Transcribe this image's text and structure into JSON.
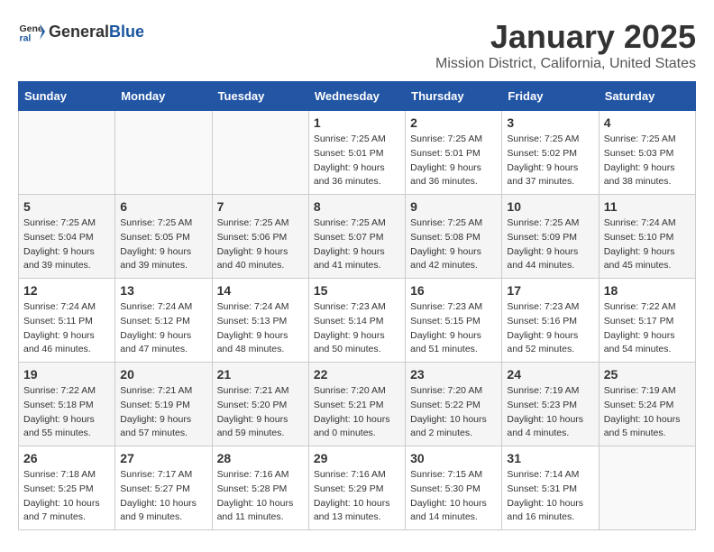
{
  "header": {
    "logo_general": "General",
    "logo_blue": "Blue",
    "title": "January 2025",
    "subtitle": "Mission District, California, United States"
  },
  "weekdays": [
    "Sunday",
    "Monday",
    "Tuesday",
    "Wednesday",
    "Thursday",
    "Friday",
    "Saturday"
  ],
  "weeks": [
    [
      {
        "day": "",
        "info": ""
      },
      {
        "day": "",
        "info": ""
      },
      {
        "day": "",
        "info": ""
      },
      {
        "day": "1",
        "info": "Sunrise: 7:25 AM\nSunset: 5:01 PM\nDaylight: 9 hours and 36 minutes."
      },
      {
        "day": "2",
        "info": "Sunrise: 7:25 AM\nSunset: 5:01 PM\nDaylight: 9 hours and 36 minutes."
      },
      {
        "day": "3",
        "info": "Sunrise: 7:25 AM\nSunset: 5:02 PM\nDaylight: 9 hours and 37 minutes."
      },
      {
        "day": "4",
        "info": "Sunrise: 7:25 AM\nSunset: 5:03 PM\nDaylight: 9 hours and 38 minutes."
      }
    ],
    [
      {
        "day": "5",
        "info": "Sunrise: 7:25 AM\nSunset: 5:04 PM\nDaylight: 9 hours and 39 minutes."
      },
      {
        "day": "6",
        "info": "Sunrise: 7:25 AM\nSunset: 5:05 PM\nDaylight: 9 hours and 39 minutes."
      },
      {
        "day": "7",
        "info": "Sunrise: 7:25 AM\nSunset: 5:06 PM\nDaylight: 9 hours and 40 minutes."
      },
      {
        "day": "8",
        "info": "Sunrise: 7:25 AM\nSunset: 5:07 PM\nDaylight: 9 hours and 41 minutes."
      },
      {
        "day": "9",
        "info": "Sunrise: 7:25 AM\nSunset: 5:08 PM\nDaylight: 9 hours and 42 minutes."
      },
      {
        "day": "10",
        "info": "Sunrise: 7:25 AM\nSunset: 5:09 PM\nDaylight: 9 hours and 44 minutes."
      },
      {
        "day": "11",
        "info": "Sunrise: 7:24 AM\nSunset: 5:10 PM\nDaylight: 9 hours and 45 minutes."
      }
    ],
    [
      {
        "day": "12",
        "info": "Sunrise: 7:24 AM\nSunset: 5:11 PM\nDaylight: 9 hours and 46 minutes."
      },
      {
        "day": "13",
        "info": "Sunrise: 7:24 AM\nSunset: 5:12 PM\nDaylight: 9 hours and 47 minutes."
      },
      {
        "day": "14",
        "info": "Sunrise: 7:24 AM\nSunset: 5:13 PM\nDaylight: 9 hours and 48 minutes."
      },
      {
        "day": "15",
        "info": "Sunrise: 7:23 AM\nSunset: 5:14 PM\nDaylight: 9 hours and 50 minutes."
      },
      {
        "day": "16",
        "info": "Sunrise: 7:23 AM\nSunset: 5:15 PM\nDaylight: 9 hours and 51 minutes."
      },
      {
        "day": "17",
        "info": "Sunrise: 7:23 AM\nSunset: 5:16 PM\nDaylight: 9 hours and 52 minutes."
      },
      {
        "day": "18",
        "info": "Sunrise: 7:22 AM\nSunset: 5:17 PM\nDaylight: 9 hours and 54 minutes."
      }
    ],
    [
      {
        "day": "19",
        "info": "Sunrise: 7:22 AM\nSunset: 5:18 PM\nDaylight: 9 hours and 55 minutes."
      },
      {
        "day": "20",
        "info": "Sunrise: 7:21 AM\nSunset: 5:19 PM\nDaylight: 9 hours and 57 minutes."
      },
      {
        "day": "21",
        "info": "Sunrise: 7:21 AM\nSunset: 5:20 PM\nDaylight: 9 hours and 59 minutes."
      },
      {
        "day": "22",
        "info": "Sunrise: 7:20 AM\nSunset: 5:21 PM\nDaylight: 10 hours and 0 minutes."
      },
      {
        "day": "23",
        "info": "Sunrise: 7:20 AM\nSunset: 5:22 PM\nDaylight: 10 hours and 2 minutes."
      },
      {
        "day": "24",
        "info": "Sunrise: 7:19 AM\nSunset: 5:23 PM\nDaylight: 10 hours and 4 minutes."
      },
      {
        "day": "25",
        "info": "Sunrise: 7:19 AM\nSunset: 5:24 PM\nDaylight: 10 hours and 5 minutes."
      }
    ],
    [
      {
        "day": "26",
        "info": "Sunrise: 7:18 AM\nSunset: 5:25 PM\nDaylight: 10 hours and 7 minutes."
      },
      {
        "day": "27",
        "info": "Sunrise: 7:17 AM\nSunset: 5:27 PM\nDaylight: 10 hours and 9 minutes."
      },
      {
        "day": "28",
        "info": "Sunrise: 7:16 AM\nSunset: 5:28 PM\nDaylight: 10 hours and 11 minutes."
      },
      {
        "day": "29",
        "info": "Sunrise: 7:16 AM\nSunset: 5:29 PM\nDaylight: 10 hours and 13 minutes."
      },
      {
        "day": "30",
        "info": "Sunrise: 7:15 AM\nSunset: 5:30 PM\nDaylight: 10 hours and 14 minutes."
      },
      {
        "day": "31",
        "info": "Sunrise: 7:14 AM\nSunset: 5:31 PM\nDaylight: 10 hours and 16 minutes."
      },
      {
        "day": "",
        "info": ""
      }
    ]
  ]
}
